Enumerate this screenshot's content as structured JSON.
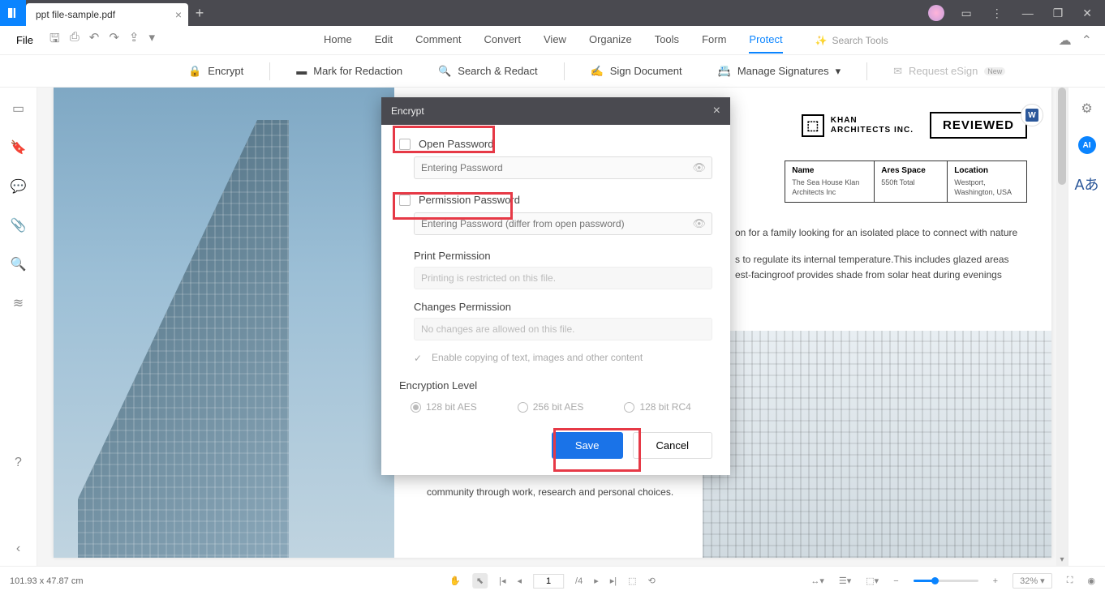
{
  "titlebar": {
    "tab_title": "ppt file-sample.pdf"
  },
  "menubar": {
    "file": "File",
    "tabs": [
      "Home",
      "Edit",
      "Comment",
      "Convert",
      "View",
      "Organize",
      "Tools",
      "Form",
      "Protect"
    ],
    "active_tab": "Protect",
    "search_placeholder": "Search Tools"
  },
  "ribbon": {
    "encrypt": "Encrypt",
    "mark_redaction": "Mark for Redaction",
    "search_redact": "Search & Redact",
    "sign_document": "Sign Document",
    "manage_signatures": "Manage Signatures",
    "request_esign": "Request eSign",
    "new_badge": "New"
  },
  "dialog": {
    "title": "Encrypt",
    "open_password": "Open Password",
    "open_placeholder": "Entering Password",
    "permission_password": "Permission Password",
    "permission_placeholder": "Entering Password (differ from open password)",
    "print_permission": "Print Permission",
    "print_value": "Printing is restricted on this file.",
    "changes_permission": "Changes Permission",
    "changes_value": "No changes are allowed on this file.",
    "enable_copy": "Enable copying of text, images and other content",
    "encryption_level": "Encryption Level",
    "radio_128aes": "128 bit AES",
    "radio_256aes": "256 bit AES",
    "radio_128rc4": "128 bit RC4",
    "save": "Save",
    "cancel": "Cancel"
  },
  "document": {
    "khan_line1": "KHAN",
    "khan_line2": "ARCHITECTS INC.",
    "reviewed": "REVIEWED",
    "info": {
      "name_h": "Name",
      "name_v1": "The Sea House Klan",
      "name_v2": "Architects Inc",
      "area_h": "Ares Space",
      "area_v": "550ft Total",
      "loc_h": "Location",
      "loc_v1": "Westport,",
      "loc_v2": "Washington, USA"
    },
    "para1": "on for a family looking for an isolated place to connect with nature",
    "para2a": "s to regulate its internal temperature.This includes glazed areas",
    "para2b": "est-facingroof provides shade from solar heat during evenings",
    "para3": "community through work, research and personal choices."
  },
  "statusbar": {
    "dims": "101.93 x 47.87 cm",
    "page_current": "1",
    "page_total": "/4",
    "zoom": "32%"
  }
}
